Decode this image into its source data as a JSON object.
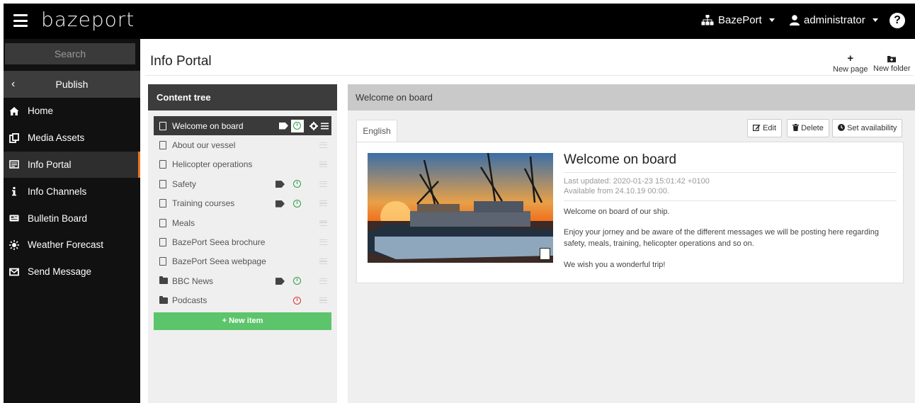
{
  "app": {
    "logo_text": "bazeport",
    "org_menu_label": "BazePort",
    "user_menu_label": "administrator"
  },
  "sidebar": {
    "search_placeholder": "Search",
    "publish_label": "Publish",
    "items": [
      {
        "label": "Home",
        "icon": "home-icon"
      },
      {
        "label": "Media Assets",
        "icon": "media-assets-icon"
      },
      {
        "label": "Info Portal",
        "icon": "info-portal-icon",
        "active": true
      },
      {
        "label": "Info Channels",
        "icon": "info-icon"
      },
      {
        "label": "Bulletin Board",
        "icon": "bulletin-board-icon"
      },
      {
        "label": "Weather Forecast",
        "icon": "weather-icon"
      },
      {
        "label": "Send Message",
        "icon": "envelope-icon"
      }
    ]
  },
  "header": {
    "title": "Info Portal",
    "new_page_label": "New page",
    "new_folder_label": "New folder"
  },
  "tree": {
    "heading": "Content tree",
    "items": [
      {
        "label": "Welcome on board",
        "kind": "page",
        "selected": true,
        "tag": true,
        "clock": "green"
      },
      {
        "label": "About our vessel",
        "kind": "page"
      },
      {
        "label": "Helicopter operations",
        "kind": "page"
      },
      {
        "label": "Safety",
        "kind": "page",
        "tag": true,
        "clock": "green"
      },
      {
        "label": "Training courses",
        "kind": "page",
        "tag": true,
        "clock": "green"
      },
      {
        "label": "Meals",
        "kind": "page"
      },
      {
        "label": "BazePort Seea brochure",
        "kind": "page"
      },
      {
        "label": "BazePort Seea webpage",
        "kind": "page"
      },
      {
        "label": "BBC News",
        "kind": "folder",
        "tag": true,
        "clock": "green"
      },
      {
        "label": "Podcasts",
        "kind": "folder",
        "clock": "red"
      }
    ],
    "new_item_label": "+ New item"
  },
  "detail": {
    "heading": "Welcome on board",
    "tab_label": "English",
    "edit_label": "Edit",
    "delete_label": "Delete",
    "availability_label": "Set availability",
    "title": "Welcome on board",
    "last_updated": "Last updated: 2020-01-23 15:01:42 +0100",
    "available_from": "Available from 24.10.19 00:00.",
    "para1": "Welcome on board of our ship.",
    "para2": "Enjoy your jorney and be aware of the different messages we will be posting here regarding safety, meals, training, helicopter operations and so on.",
    "para3": "We wish you a wonderful trip!"
  },
  "colors": {
    "accent": "#e87722",
    "new_item_green": "#5cc46a",
    "clock_green": "#2f9e44",
    "clock_red": "#e03131"
  }
}
